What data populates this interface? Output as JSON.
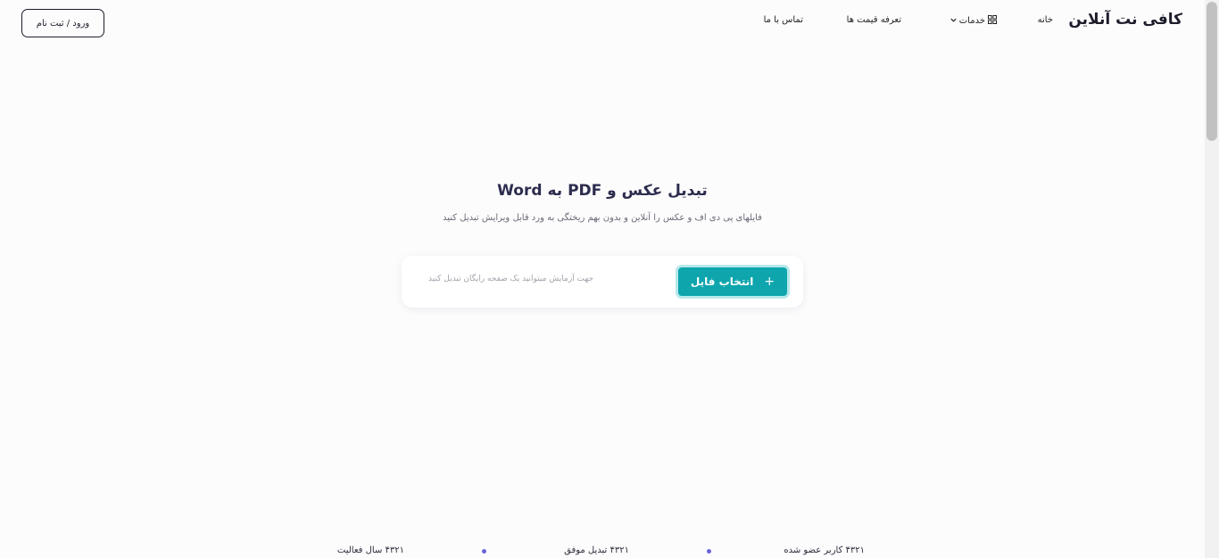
{
  "header": {
    "brand": "کافی نت آنلاین",
    "nav": {
      "home": "خانه",
      "services": "خدمات",
      "pricing": "تعرفه قیمت ها",
      "contact": "تماس با ما"
    },
    "login_label": "ورود / ثبت نام"
  },
  "hero": {
    "title": "تبدیل عکس و PDF به Word",
    "subtitle": "فایلهای پی دی اف و عکس را آنلاین و بدون بهم ریختگی به ورد قابل ویرایش تبدیل کنید",
    "upload_label": "انتخاب فایل",
    "upload_hint": "جهت آزمایش میتوانید یک صفحه رایگان تبدیل کنید"
  },
  "stats": [
    {
      "label": "۴۳۲۱ کاربر عضو شده"
    },
    {
      "label": "۴۳۲۱ تبدیل موفق"
    },
    {
      "label": "۴۳۲۱ سال فعالیت"
    }
  ],
  "icons": {
    "services_grid": "grid-icon",
    "services_chevron": "chevron-down-icon",
    "upload_plus": "plus-icon"
  },
  "colors": {
    "accent": "#0ea5ad",
    "accent_ring": "#b7e8ea",
    "title": "#2c2c4e",
    "dot": "#6a64d8"
  }
}
